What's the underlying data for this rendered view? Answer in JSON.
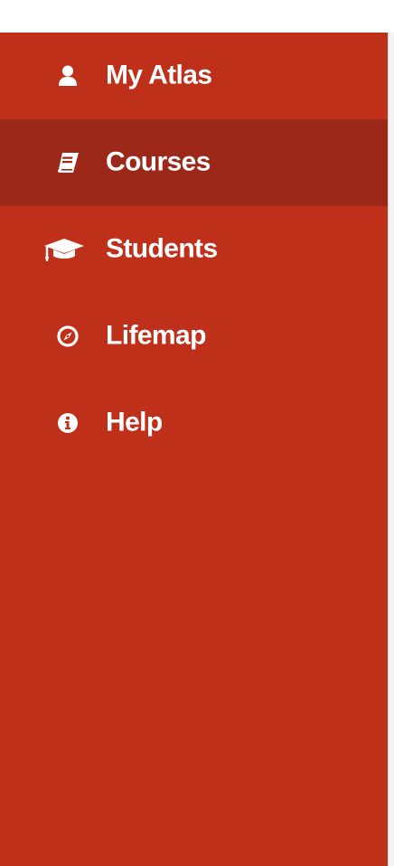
{
  "colors": {
    "sidebar_bg": "#bf301b",
    "active_bg": "#9b2818",
    "text": "#ffffff"
  },
  "sidebar": {
    "items": [
      {
        "label": "My Atlas",
        "icon": "user-icon",
        "active": false
      },
      {
        "label": "Courses",
        "icon": "book-icon",
        "active": true
      },
      {
        "label": "Students",
        "icon": "graduation-cap-icon",
        "active": false
      },
      {
        "label": "Lifemap",
        "icon": "compass-icon",
        "active": false
      },
      {
        "label": "Help",
        "icon": "info-circle-icon",
        "active": false
      }
    ]
  }
}
